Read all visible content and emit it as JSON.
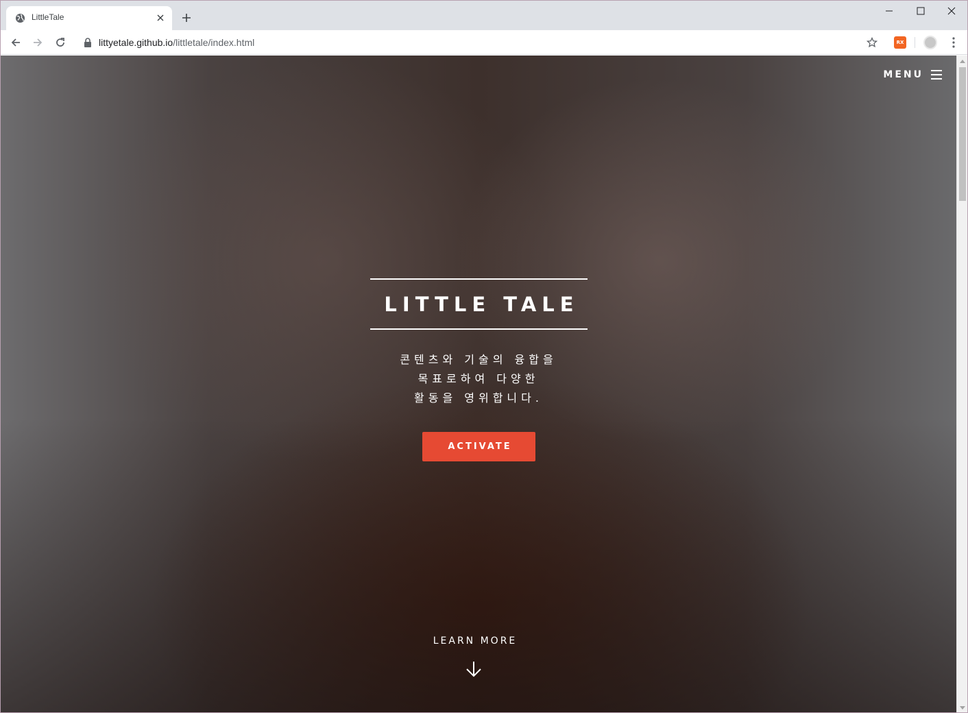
{
  "browser": {
    "tab_title": "LittleTale",
    "url_host": "littyetale.github.io",
    "url_path": "/littletale/index.html",
    "extension_label": "RX"
  },
  "page": {
    "menu_label": "MENU",
    "title": "LITTLE TALE",
    "subtitle_lines": [
      "콘텐츠와 기술의 융합을",
      "목표로하여 다양한",
      "활동을 영위합니다."
    ],
    "activate_label": "ACTIVATE",
    "learn_more_label": "LEARN MORE"
  },
  "colors": {
    "accent": "#e64a33",
    "tab_strip": "#dee1e6",
    "text_light": "#ffffff"
  },
  "icons": {
    "favicon": "globe-icon",
    "menu": "hamburger-icon",
    "learn_more": "arrow-down-icon"
  }
}
